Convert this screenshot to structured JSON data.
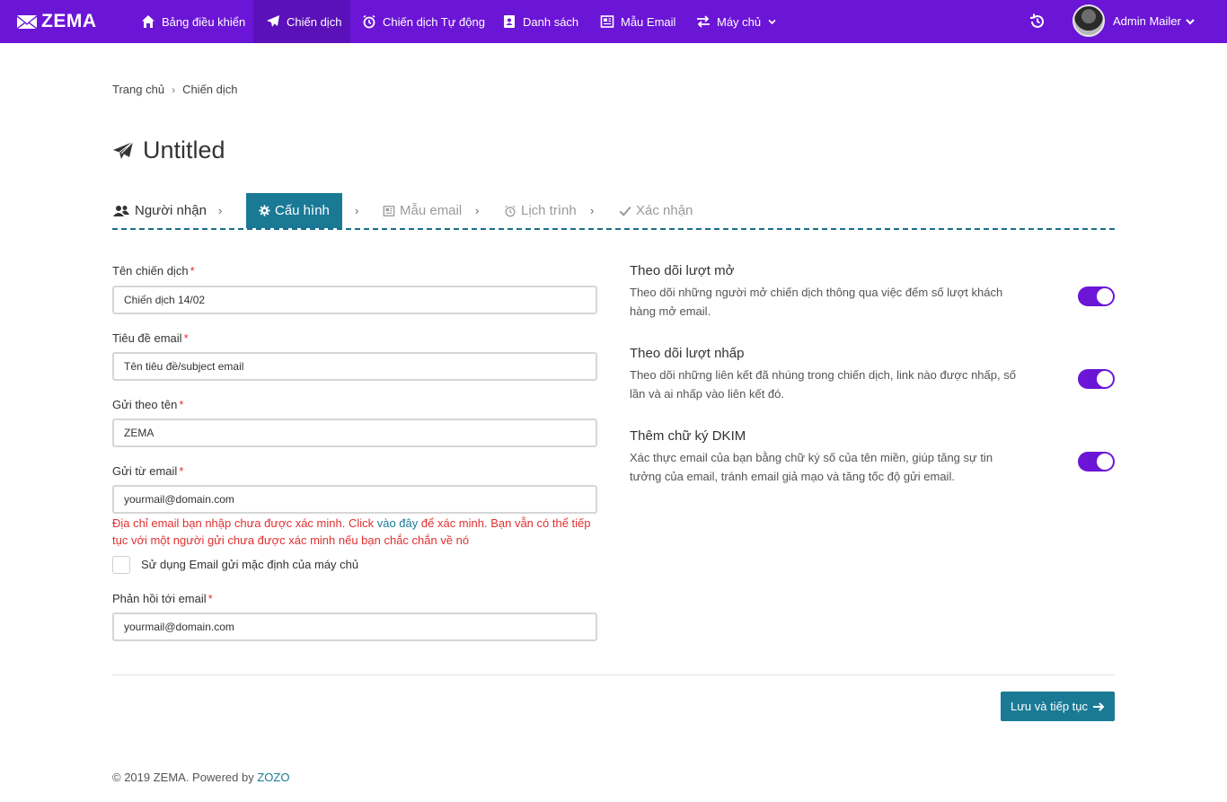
{
  "brand": {
    "logo_text": "ZEMA",
    "logo_icon": "mail-bird-icon",
    "accent": "#6b15d6",
    "primary": "#1a7a96",
    "error": "#e03131"
  },
  "nav": {
    "items": [
      {
        "label": "Bảng điều khiển",
        "icon": "home-icon"
      },
      {
        "label": "Chiến dịch",
        "icon": "paper-plane-icon",
        "active": true
      },
      {
        "label": "Chiến dịch Tự động",
        "icon": "alarm-clock-icon"
      },
      {
        "label": "Danh sách",
        "icon": "contacts-book-icon"
      },
      {
        "label": "Mẫu Email",
        "icon": "newspaper-icon"
      },
      {
        "label": "Máy chủ",
        "icon": "exchange-arrows-icon",
        "has_dropdown": true
      }
    ],
    "user_name": "Admin Mailer"
  },
  "breadcrumb": {
    "home": "Trang chủ",
    "current": "Chiến dịch"
  },
  "page_title": "Untitled",
  "steps": [
    {
      "label": "Người nhận",
      "icon": "users-icon",
      "state": "done"
    },
    {
      "label": "Cấu hình",
      "icon": "gear-icon",
      "state": "active"
    },
    {
      "label": "Mẫu email",
      "icon": "newspaper-icon",
      "state": "disabled"
    },
    {
      "label": "Lịch trình",
      "icon": "alarm-clock-icon",
      "state": "disabled"
    },
    {
      "label": "Xác nhận",
      "icon": "check-icon",
      "state": "disabled"
    }
  ],
  "form": {
    "campaign_name": {
      "label": "Tên chiến dịch",
      "value": "Chiến dịch 14/02"
    },
    "subject": {
      "label": "Tiêu đề email",
      "value": "Tên tiêu đề/subject email"
    },
    "from_name": {
      "label": "Gửi theo tên",
      "value": "ZEMA"
    },
    "from_email": {
      "label": "Gửi từ email",
      "value": "yourmail@domain.com",
      "warning_before": "Địa chỉ email bạn nhập chưa được xác minh. Click ",
      "warning_link": "vào đây",
      "warning_after": " để xác minh. Bạn vẫn có thể tiếp tục với một người gửi chưa được xác minh nếu bạn chắc chắn về nó"
    },
    "use_default_sender": {
      "label": "Sử dụng Email gửi mặc định của máy chủ",
      "checked": false
    },
    "reply_to": {
      "label": "Phản hồi tới email",
      "value": "yourmail@domain.com"
    }
  },
  "options": [
    {
      "title": "Theo dõi lượt mở",
      "desc": "Theo dõi những người mở chiến dịch thông qua việc đếm số lượt khách hàng mở email.",
      "enabled": true
    },
    {
      "title": "Theo dõi lượt nhấp",
      "desc": "Theo dõi những liên kết đã nhúng trong chiến dịch, link nào được nhấp, số lần và ai nhấp vào liên kết đó.",
      "enabled": true
    },
    {
      "title": "Thêm chữ ký DKIM",
      "desc": "Xác thực email của bạn bằng chữ ký số của tên miền, giúp tăng sự tin tưởng của email, tránh email giả mạo và tăng tốc độ gửi email.",
      "enabled": true
    }
  ],
  "actions": {
    "save_continue": "Lưu và tiếp tục"
  },
  "footer": {
    "text": "© 2019 ZEMA. Powered by ",
    "brand": "ZOZO"
  }
}
